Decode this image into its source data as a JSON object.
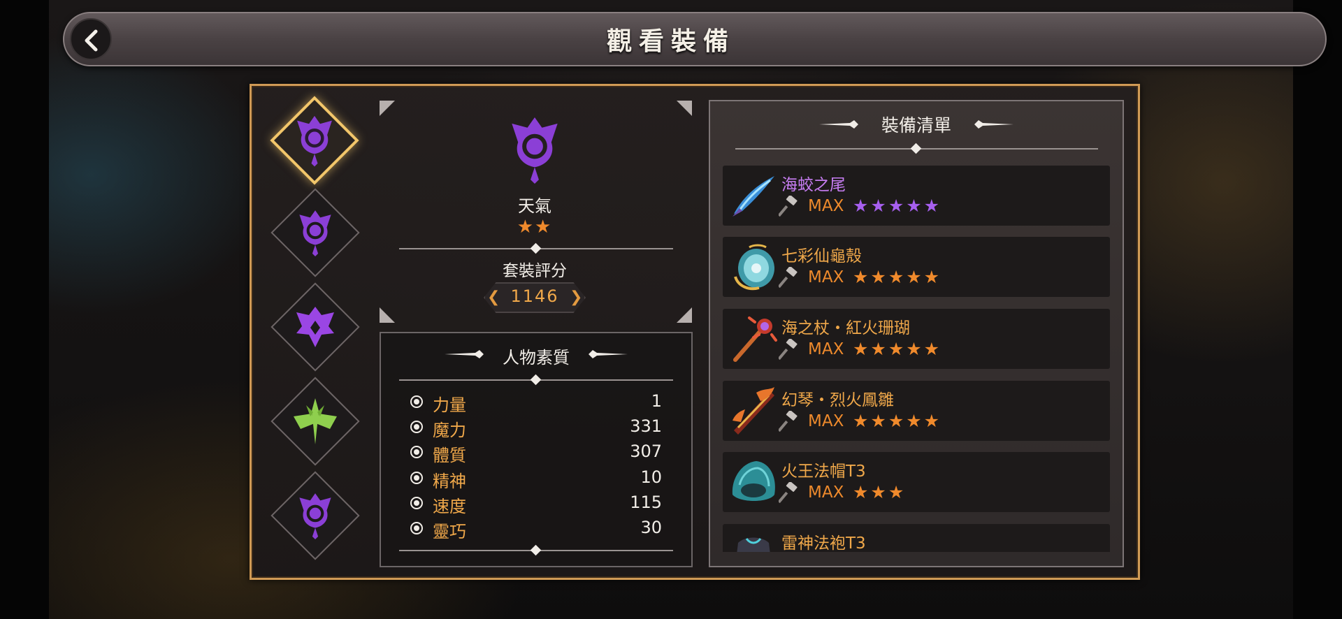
{
  "header": {
    "title": "觀看裝備",
    "back_icon": "chevron-left-icon"
  },
  "slots": [
    {
      "icon": "purple-crest-icon",
      "active": true
    },
    {
      "icon": "purple-crest-icon",
      "active": false
    },
    {
      "icon": "purple-wing-crest-icon",
      "active": false
    },
    {
      "icon": "green-leaf-cross-icon",
      "active": false
    },
    {
      "icon": "purple-crest-icon",
      "active": false
    }
  ],
  "set": {
    "icon": "purple-crest-icon",
    "name": "天氣",
    "stars": "★★",
    "score_label": "套裝評分",
    "score": "1146"
  },
  "attributes": {
    "title": "人物素質",
    "items": [
      {
        "name": "力量",
        "value": "1"
      },
      {
        "name": "魔力",
        "value": "331"
      },
      {
        "name": "體質",
        "value": "307"
      },
      {
        "name": "精神",
        "value": "10"
      },
      {
        "name": "速度",
        "value": "115"
      },
      {
        "name": "靈巧",
        "value": "30"
      }
    ]
  },
  "equipment": {
    "title": "裝備清單",
    "items": [
      {
        "name": "海蛟之尾",
        "level": "MAX",
        "stars": "★★★★★",
        "name_color": "#c77df2",
        "star_color": "#a75ff0",
        "icon": "blue-blade-icon"
      },
      {
        "name": "七彩仙龜殼",
        "level": "MAX",
        "stars": "★★★★★",
        "name_color": "#f0a84a",
        "star_color": "#f08a2c",
        "icon": "shell-shield-icon"
      },
      {
        "name": "海之杖・紅火珊瑚",
        "level": "MAX",
        "stars": "★★★★★",
        "name_color": "#f0a84a",
        "star_color": "#f08a2c",
        "icon": "coral-staff-icon"
      },
      {
        "name": "幻琴・烈火鳳雛",
        "level": "MAX",
        "stars": "★★★★★",
        "name_color": "#f0a84a",
        "star_color": "#f08a2c",
        "icon": "fire-harp-icon"
      },
      {
        "name": "火王法帽T3",
        "level": "MAX",
        "stars": "★★★",
        "name_color": "#f0a84a",
        "star_color": "#f08a2c",
        "icon": "teal-hat-icon"
      },
      {
        "name": "雷神法袍T3",
        "level": "",
        "stars": "",
        "name_color": "#f0a84a",
        "star_color": "#f08a2c",
        "icon": "dark-robe-icon"
      }
    ]
  },
  "colors": {
    "frame": "#d09a55",
    "accent_orange": "#f0a84a",
    "accent_purple": "#a75ff0"
  }
}
